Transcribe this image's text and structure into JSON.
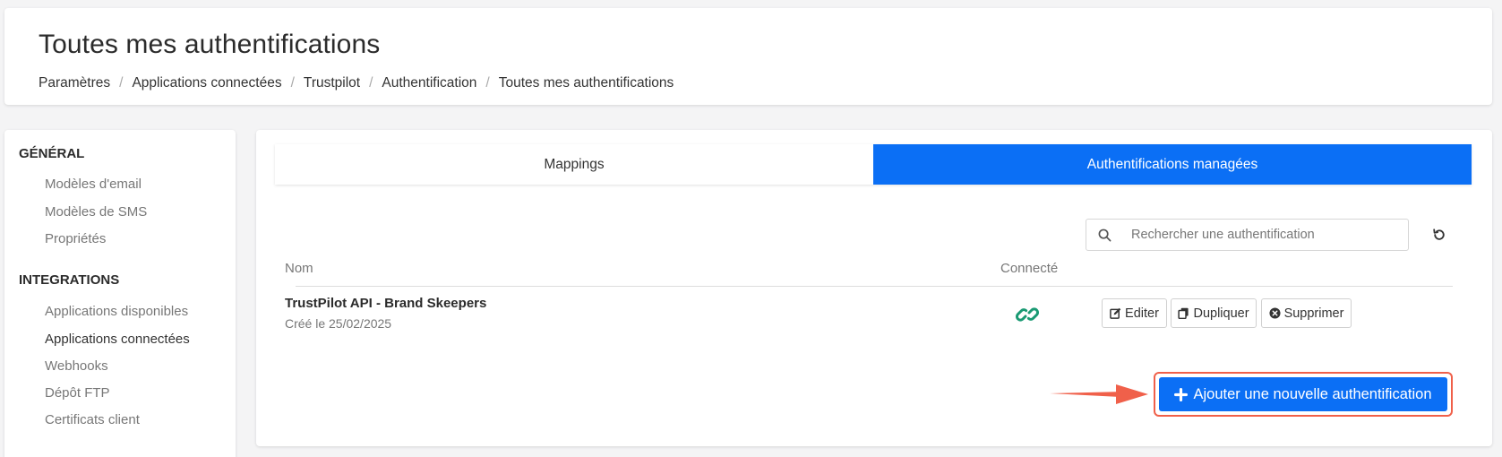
{
  "header": {
    "title": "Toutes mes authentifications",
    "breadcrumb": [
      "Paramètres",
      "Applications connectées",
      "Trustpilot",
      "Authentification",
      "Toutes mes authentifications"
    ]
  },
  "sidebar": {
    "sections": [
      {
        "title": "GÉNÉRAL",
        "items": [
          "Modèles d'email",
          "Modèles de SMS",
          "Propriétés"
        ]
      },
      {
        "title": "INTEGRATIONS",
        "items": [
          "Applications disponibles",
          "Applications connectées",
          "Webhooks",
          "Dépôt FTP",
          "Certificats client"
        ]
      }
    ],
    "active_item": "Applications connectées"
  },
  "tabs": [
    {
      "label": "Mappings",
      "active": false
    },
    {
      "label": "Authentifications managées",
      "active": true
    }
  ],
  "search": {
    "placeholder": "Rechercher une authentification",
    "value": ""
  },
  "table": {
    "columns": [
      "Nom",
      "Connecté"
    ],
    "rows": [
      {
        "name": "TrustPilot API - Brand Skeepers",
        "created": "Créé le 25/02/2025",
        "connected": true
      }
    ],
    "actions": {
      "edit": "Editer",
      "duplicate": "Dupliquer",
      "delete": "Supprimer"
    }
  },
  "add_button": {
    "label": "Ajouter une nouvelle authentification"
  },
  "icons": {
    "search": "search-icon",
    "refresh": "refresh-icon",
    "connected": "link-icon",
    "edit": "edit-icon",
    "duplicate": "copy-icon",
    "delete": "delete-icon",
    "add": "plus-icon",
    "annotation": "arrow-icon"
  },
  "colors": {
    "primary": "#0b6ff5",
    "connected": "#1a9a73",
    "highlight": "#f0604a"
  }
}
